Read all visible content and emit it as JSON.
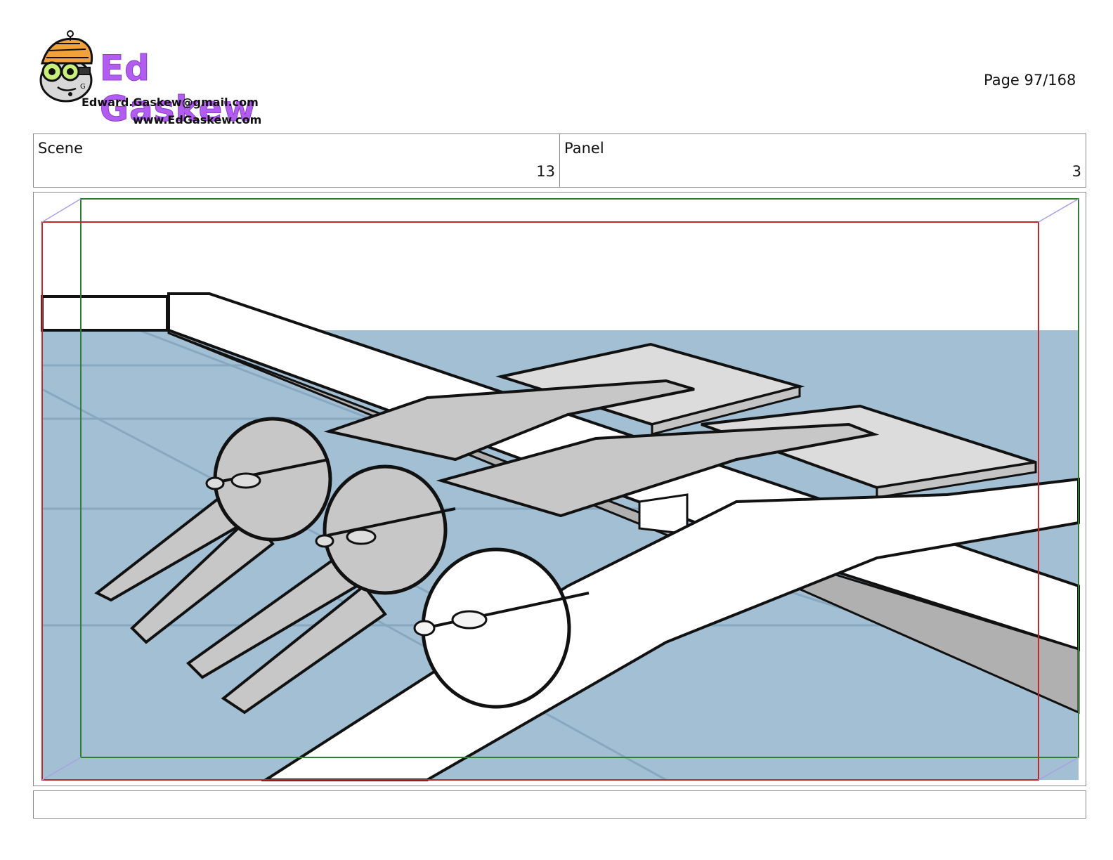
{
  "header": {
    "brand": "Ed Gaskew",
    "email": "Edward.Gaskew@gmail.com",
    "website": "www.EdGaskew.com",
    "page_number": "Page  97/168"
  },
  "info": {
    "scene_label": "Scene",
    "scene_value": "13",
    "panel_label": "Panel",
    "panel_value": "3"
  },
  "panel": {
    "description_visible": false
  },
  "colors": {
    "pool_water": "#a3bfd3",
    "action_safe": "#c0282d",
    "title_safe": "#2e7d32",
    "brand": "#b25cf0"
  },
  "caption": {
    "text": ""
  }
}
